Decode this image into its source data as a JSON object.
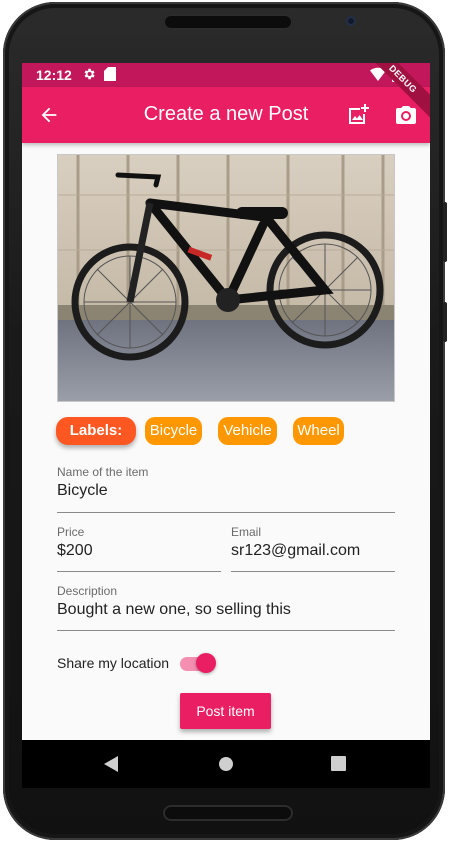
{
  "status_bar": {
    "time": "12:12",
    "icons": [
      "gear-icon",
      "sd-card-icon",
      "wifi-icon",
      "battery-icon"
    ]
  },
  "debug_banner": "DEBUG",
  "app_bar": {
    "title": "Create a new Post",
    "back_icon": "arrow-back-icon",
    "actions": [
      "add-photo-icon",
      "camera-icon"
    ]
  },
  "image": {
    "subject": "black mountain bicycle leaning on wall"
  },
  "labels": {
    "heading": "Labels:",
    "chips": [
      "Bicycle",
      "Vehicle",
      "Wheel"
    ]
  },
  "form": {
    "name": {
      "label": "Name of the item",
      "value": "Bicycle"
    },
    "price": {
      "label": "Price",
      "value": "$200"
    },
    "email": {
      "label": "Email",
      "value": "sr123@gmail.com"
    },
    "description": {
      "label": "Description",
      "value": "Bought a new one, so selling this"
    },
    "share_location": {
      "label": "Share my location",
      "enabled": true
    }
  },
  "post_button": "Post item",
  "nav_bar": [
    "back-icon",
    "home-icon",
    "recents-icon"
  ],
  "colors": {
    "primary": "#e91e63",
    "status_bar": "#c2185b",
    "labels_chip": "#ff5722",
    "chip": "#ff9800"
  }
}
